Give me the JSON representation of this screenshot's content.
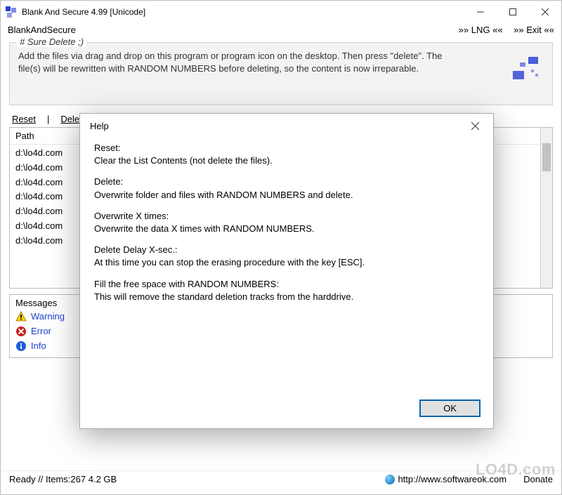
{
  "titlebar": {
    "title": "Blank And Secure 4.99 [Unicode]"
  },
  "menubar": {
    "app": "BlankAndSecure",
    "lng": "»»  LNG  ««",
    "exit": "»»  Exit  ««"
  },
  "groupbox": {
    "title": "# Sure Delete ;)",
    "text": "Add the files via drag and drop on this program or program icon on the desktop. Then press \"delete\". The file(s) will be rewritten with RANDOM NUMBERS before deleting, so the content is now irreparable."
  },
  "actions": {
    "reset": "Reset",
    "delete": "Delete"
  },
  "list": {
    "header_path": "Path",
    "rows": [
      "d:\\lo4d.com",
      "d:\\lo4d.com",
      "d:\\lo4d.com",
      "d:\\lo4d.com",
      "d:\\lo4d.com",
      "d:\\lo4d.com",
      "d:\\lo4d.com"
    ]
  },
  "messages": {
    "header": "Messages",
    "warning": "Warning",
    "error": "Error",
    "info": "Info"
  },
  "statusbar": {
    "ready": "Ready // Items:267 4.2 GB",
    "url": "http://www.softwareok.com",
    "donate": "Donate"
  },
  "dialog": {
    "title": "Help",
    "sections": [
      {
        "h": "Reset:",
        "t": "Clear the List Contents (not delete the files)."
      },
      {
        "h": "Delete:",
        "t": "Overwrite folder and files with RANDOM NUMBERS and delete."
      },
      {
        "h": "Overwrite X times:",
        "t": "Overwrite the data X times with RANDOM NUMBERS."
      },
      {
        "h": "Delete Delay X-sec.:",
        "t": "At this time you can stop the erasing procedure with the key [ESC]."
      },
      {
        "h": "Fill the free space with RANDOM NUMBERS:",
        "t": "This will remove the standard deletion tracks from the harddrive."
      }
    ],
    "ok": "OK"
  },
  "watermark": "LO4D.com"
}
